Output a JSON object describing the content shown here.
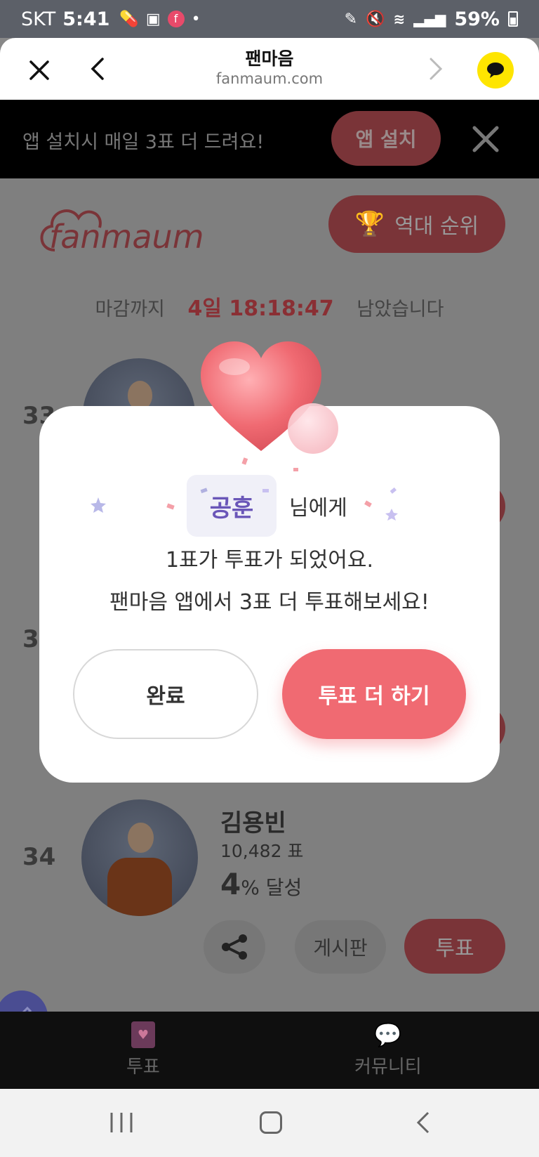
{
  "status_bar": {
    "carrier": "SKT",
    "time": "5:41",
    "battery": "59%"
  },
  "browser": {
    "title": "팬마음",
    "url": "fanmaum.com"
  },
  "install_banner": {
    "text": "앱 설치시 매일 3표 더 드려요!",
    "button": "앱 설치"
  },
  "header": {
    "logo_text": "fanmaum",
    "rank_button": "역대 순위"
  },
  "deadline": {
    "prefix": "마감까지",
    "countdown": "4일 18:18:47",
    "suffix": "남았습니다"
  },
  "list": {
    "partial_rank_1": "33",
    "partial_rank_2": "3",
    "item": {
      "rank": "34",
      "name": "김용빈",
      "votes": "10,482 표",
      "percent": "4",
      "percent_suffix": "% 달성",
      "board_button": "게시판",
      "vote_button": "투표"
    }
  },
  "tabs": {
    "vote": "투표",
    "community": "커뮤니티"
  },
  "modal": {
    "recipient": "공훈",
    "recipient_suffix": "님에게",
    "line1": "1표가 투표가 되었어요.",
    "line2": "팬마음 앱에서 3표 더 투표해보세요!",
    "done_button": "완료",
    "more_button": "투표 더 하기"
  },
  "colors": {
    "accent": "#f06a72",
    "chip_text": "#6a56b8",
    "kakao": "#fee500"
  }
}
